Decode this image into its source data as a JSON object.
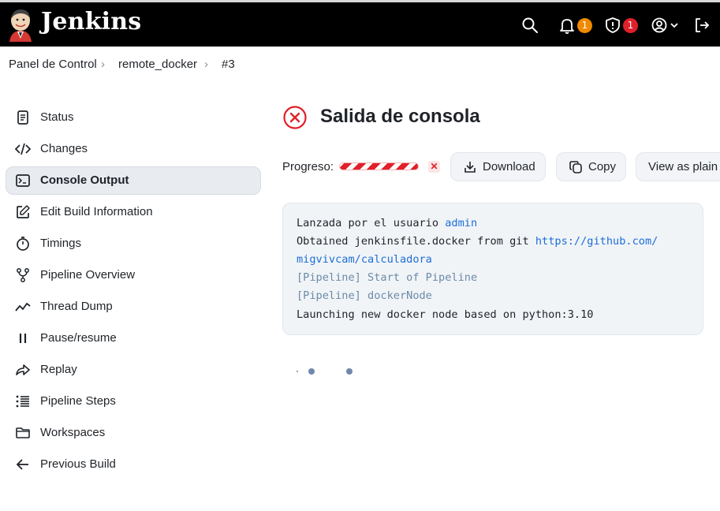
{
  "header": {
    "brand": "Jenkins",
    "notifications_count": "1",
    "security_count": "1",
    "icons": [
      "jenkins-logo",
      "search-icon",
      "bell-icon",
      "shield-icon",
      "user-icon",
      "chevron-down-icon",
      "logout-icon"
    ],
    "colors": {
      "bar": "#000000",
      "notif_badge": "#f08a00",
      "security_badge": "#e0202a"
    }
  },
  "breadcrumb": {
    "items": [
      "Panel de Control",
      "remote_docker",
      "#3"
    ]
  },
  "sidebar": {
    "items": [
      {
        "label": "Status",
        "icon": "document-icon"
      },
      {
        "label": "Changes",
        "icon": "code-icon"
      },
      {
        "label": "Console Output",
        "icon": "terminal-icon",
        "active": true
      },
      {
        "label": "Edit Build Information",
        "icon": "edit-icon"
      },
      {
        "label": "Timings",
        "icon": "stopwatch-icon"
      },
      {
        "label": "Pipeline Overview",
        "icon": "branch-icon"
      },
      {
        "label": "Thread Dump",
        "icon": "activity-icon"
      },
      {
        "label": "Pause/resume",
        "icon": "pause-icon"
      },
      {
        "label": "Replay",
        "icon": "replay-icon"
      },
      {
        "label": "Pipeline Steps",
        "icon": "list-icon"
      },
      {
        "label": "Workspaces",
        "icon": "folder-icon"
      },
      {
        "label": "Previous Build",
        "icon": "arrow-left-icon"
      }
    ]
  },
  "main": {
    "title": "Salida de consola",
    "status": "failed",
    "progress_label": "Progreso:",
    "buttons": {
      "download": "Download",
      "copy": "Copy",
      "plain": "View as plain text"
    },
    "console": {
      "line1_text": "Lanzada por el usuario ",
      "line1_link": "admin",
      "line2_text": "Obtained jenkinsfile.docker from git ",
      "line2_link_a": "https://github.com/",
      "line2_link_b": "migvivcam/calculadora",
      "line3": "[Pipeline] Start of Pipeline",
      "line4": "[Pipeline] dockerNode",
      "line5": "Launching new docker node based on python:3.10"
    },
    "spinner": "loading-dots"
  }
}
